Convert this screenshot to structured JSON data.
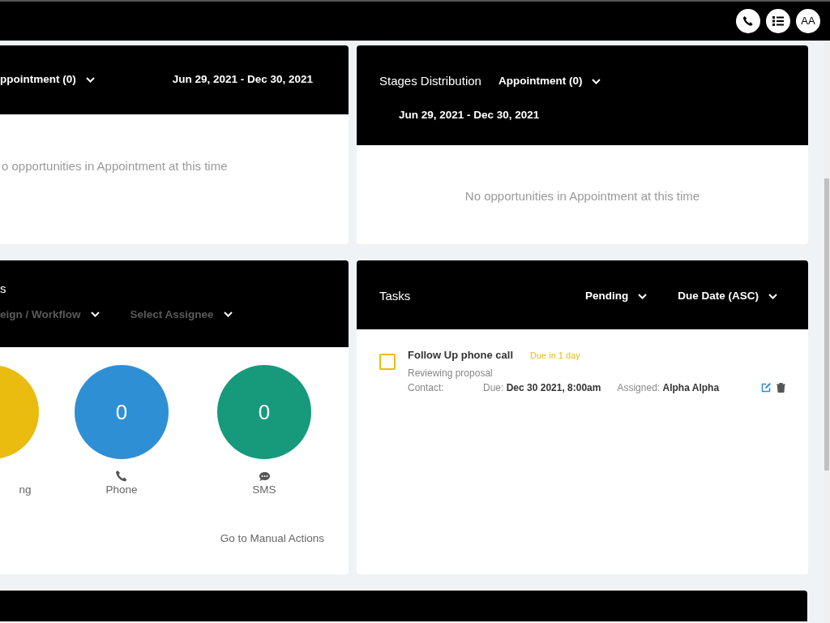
{
  "top_bar": {
    "avatar": "AA"
  },
  "opportunities_card": {
    "stage_filter": "ppointment (0)",
    "date_range": "Jun 29, 2021 - Dec 30, 2021",
    "empty_message": "o opportunities in Appointment at this time"
  },
  "stages_card": {
    "title": "Stages Distribution",
    "stage_filter": "Appointment (0)",
    "date_range": "Jun 29, 2021 - Dec 30, 2021",
    "empty_message": "No opportunities in Appointment at this time"
  },
  "manual_actions_card": {
    "title": "s",
    "filters": [
      {
        "label": "eign / Workflow"
      },
      {
        "label": "Select Assignee"
      }
    ],
    "counters": [
      {
        "kind": "cut",
        "label": "ng",
        "color": "#e9bc0f"
      },
      {
        "kind": "phone",
        "count": "0",
        "label": "Phone",
        "color": "#2f8fd5"
      },
      {
        "kind": "sms",
        "count": "0",
        "label": "SMS",
        "color": "#169a7b"
      }
    ],
    "link": "Go to Manual Actions"
  },
  "tasks_card": {
    "title": "Tasks",
    "status_filter": "Pending",
    "sort_filter": "Due Date (ASC)",
    "tasks": [
      {
        "title": "Follow Up phone call",
        "due_badge": "Due in 1 day",
        "description": "Reviewing proposal",
        "contact_label": "Contact:",
        "due_label": "Due:",
        "due_value": "Dec 30 2021, 8:00am",
        "assigned_label": "Assigned:",
        "assigned_value": "Alpha Alpha",
        "checked": false
      }
    ]
  }
}
